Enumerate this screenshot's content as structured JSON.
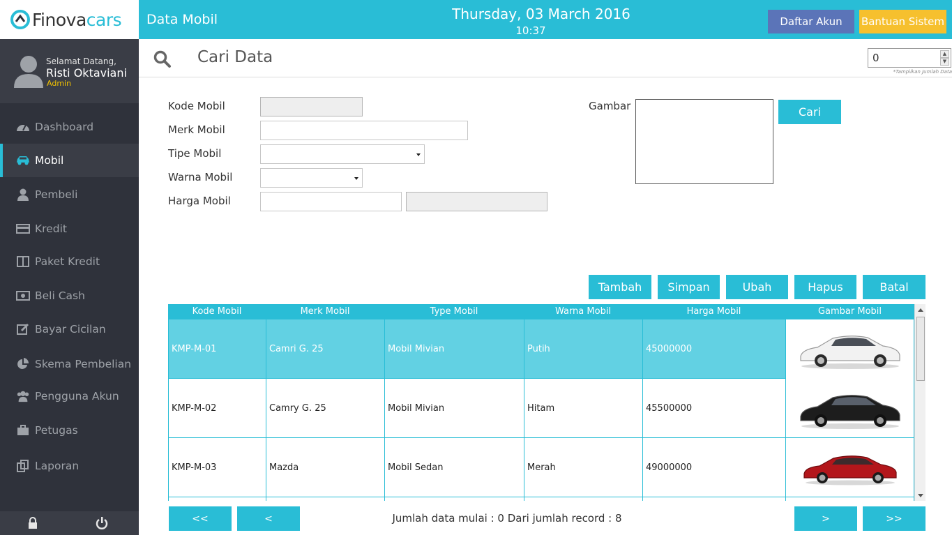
{
  "app": {
    "logo_part1": "Finova",
    "logo_part2": "cars"
  },
  "profile": {
    "greeting": "Selamat Datang,",
    "name": "Risti Oktaviani",
    "role": "Admin"
  },
  "nav": {
    "items": [
      {
        "label": "Dashboard",
        "icon": "dashboard-icon"
      },
      {
        "label": "Mobil",
        "icon": "car-icon",
        "active": true
      },
      {
        "label": "Pembeli",
        "icon": "user-icon"
      },
      {
        "label": "Kredit",
        "icon": "credit-card-icon"
      },
      {
        "label": "Paket Kredit",
        "icon": "columns-icon"
      },
      {
        "label": "Beli Cash",
        "icon": "money-icon"
      },
      {
        "label": "Bayar Cicilan",
        "icon": "edit-icon"
      },
      {
        "label": "Skema Pembelian",
        "icon": "pie-chart-icon"
      },
      {
        "label": "Pengguna Akun",
        "icon": "users-icon"
      },
      {
        "label": "Petugas",
        "icon": "briefcase-icon"
      },
      {
        "label": "Laporan",
        "icon": "copy-icon"
      }
    ]
  },
  "header": {
    "page_title": "Data Mobil",
    "date": "Thursday, 03 March 2016",
    "time": "10:37",
    "btn_akun": "Daftar Akun",
    "btn_bantuan": "Bantuan Sistem",
    "accent": "#29bdd6"
  },
  "search": {
    "title": "Cari Data",
    "count_value": "0",
    "count_note": "*Tampilkan Jumlah Data"
  },
  "form": {
    "kode_label": "Kode Mobil",
    "merk_label": "Merk Mobil",
    "tipe_label": "Tipe Mobil",
    "warna_label": "Warna Mobil",
    "harga_label": "Harga Mobil",
    "gambar_label": "Gambar",
    "cari_button": "Cari"
  },
  "actions": {
    "tambah": "Tambah",
    "simpan": "Simpan",
    "ubah": "Ubah",
    "hapus": "Hapus",
    "batal": "Batal"
  },
  "table": {
    "headers": [
      "Kode Mobil",
      "Merk Mobil",
      "Type Mobil",
      "Warna Mobil",
      "Harga Mobil",
      "Gambar Mobil"
    ],
    "rows": [
      {
        "kode": "KMP-M-01",
        "merk": "Camri G. 25",
        "type": "Mobil Mivian",
        "warna": "Putih",
        "harga": "45000000",
        "car_color": "#f2f2f2"
      },
      {
        "kode": "KMP-M-02",
        "merk": "Camry G. 25",
        "type": "Mobil Mivian",
        "warna": "Hitam",
        "harga": "45500000",
        "car_color": "#1d1d1d"
      },
      {
        "kode": "KMP-M-03",
        "merk": "Mazda",
        "type": "Mobil Sedan",
        "warna": "Merah",
        "harga": "49000000",
        "car_color": "#b3161b"
      }
    ]
  },
  "pager": {
    "first": "<<",
    "prev": "<",
    "next": ">",
    "last": ">>",
    "info": "Jumlah data mulai : 0 Dari jumlah record : 8"
  }
}
